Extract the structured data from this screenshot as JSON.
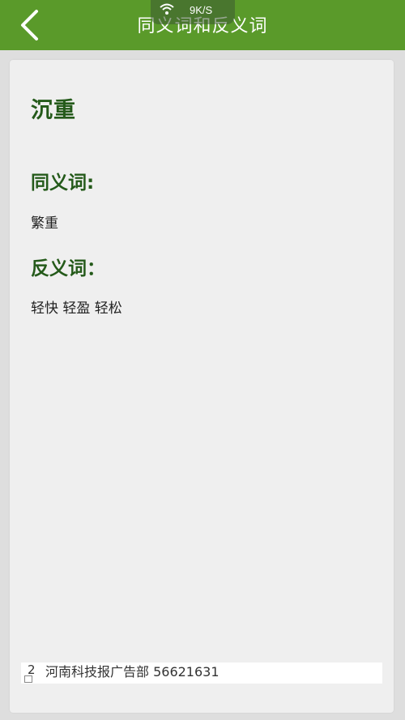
{
  "header": {
    "title": "同义词和反义词",
    "net_speed": "9K/S"
  },
  "entry": {
    "word": "沉重",
    "synonyms_heading": "同义词:",
    "synonyms": "繁重",
    "antonyms_heading": "反义词：",
    "antonyms": "轻快 轻盈 轻松"
  },
  "ad": {
    "number": "2",
    "text": "河南科技报广告部 56621631"
  },
  "colors": {
    "header_bg": "#5a9a2a",
    "heading_text": "#245a1a",
    "card_bg": "#efefef",
    "page_bg": "#dedede"
  },
  "icons": {
    "back": "chevron-left-icon",
    "wifi": "wifi-icon",
    "ad": "ad-square-icon"
  }
}
